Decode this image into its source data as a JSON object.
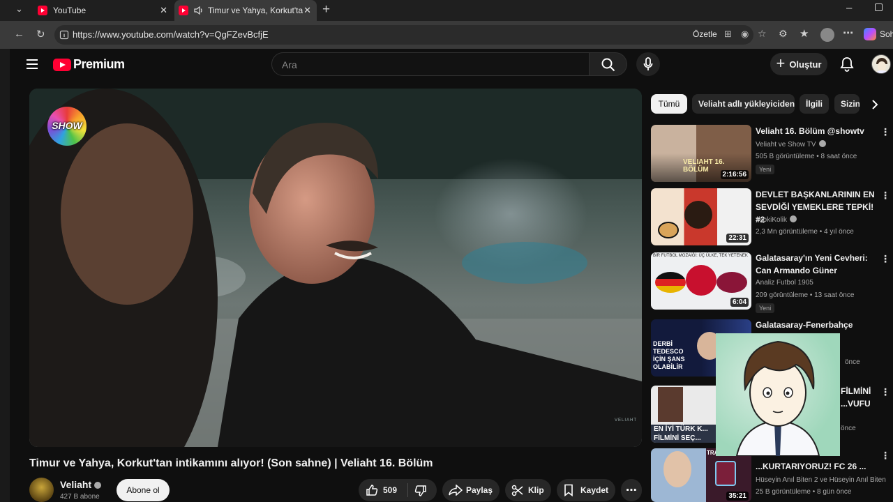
{
  "browser": {
    "tabs": [
      {
        "title": "YouTube"
      },
      {
        "title": "Timur ve Yahya, Korkut'tan inti"
      }
    ],
    "url": "https://www.youtube.com/watch?v=QgFZevBcfjE",
    "summarize_label": "Özetle",
    "copilot_label": "Soh"
  },
  "header": {
    "logo_text": "Premium",
    "search_placeholder": "Ara",
    "create_label": "Oluştur"
  },
  "player": {
    "channel_logo_text": "SHOW",
    "watermark": "VELIAHT"
  },
  "video": {
    "title": "Timur ve Yahya, Korkut'tan intikamını alıyor! (Son sahne) | Veliaht 16. Bölüm",
    "channel": "Veliaht",
    "subscribers": "427 B abone",
    "subscribe_label": "Abone ol",
    "likes": "509",
    "share_label": "Paylaş",
    "clip_label": "Klip",
    "save_label": "Kaydet"
  },
  "chips": [
    "Tümü",
    "Veliaht adlı yükleyiciden",
    "İlgili",
    "Sizin için"
  ],
  "recommendations": [
    {
      "title": "Veliaht 16. Bölüm @showtv",
      "channel": "Veliaht ve Show TV",
      "meta": "505 B görüntüleme • 8 saat önce",
      "badge": "Yeni",
      "duration": "2:16:56",
      "thumb_text": "VELIAHT 16. BÖLÜM"
    },
    {
      "title": "DEVLET BAŞKANLARININ EN SEVDİĞİ YEMEKLERE TEPKİ! #2",
      "channel": "TepkiKolik",
      "meta": "2,3 Mn görüntüleme • 4 yıl önce",
      "badge": "",
      "duration": "22:31",
      "thumb_text": ""
    },
    {
      "title": "Galatasaray'ın Yeni Cevheri: Can Armando Güner",
      "channel": "Analiz Futbol 1905",
      "meta": "209 görüntüleme • 13 saat önce",
      "badge": "Yeni",
      "duration": "6:04",
      "thumb_text": "BİR FUTBOL MOZAİĞİ: ÜÇ ÜLKE, TEK YETENEK"
    },
    {
      "title": "Galatasaray-Fenerbahçe derbisi ...",
      "channel": "",
      "meta": "önce",
      "badge": "",
      "duration": "",
      "thumb_text": "DERBİ TEDESCO İÇİN ŞANS OLABİLİR"
    },
    {
      "title": "FİLMİNİ ...VUFU",
      "channel": "",
      "meta": "önce",
      "badge": "",
      "duration": "",
      "thumb_text": "EN İYİ TÜRK K... FİLMİNİ SEÇ..."
    },
    {
      "title": "...KURTARIYORUZ! FC 26 ...",
      "channel": "Hüseyin Anıl Biten 2 ve Hüseyin Anıl Biten",
      "meta": "25 B görüntüleme • 8 gün önce",
      "badge": "",
      "duration": "35:21",
      "thumb_text": "TRABZONSPOR"
    }
  ]
}
